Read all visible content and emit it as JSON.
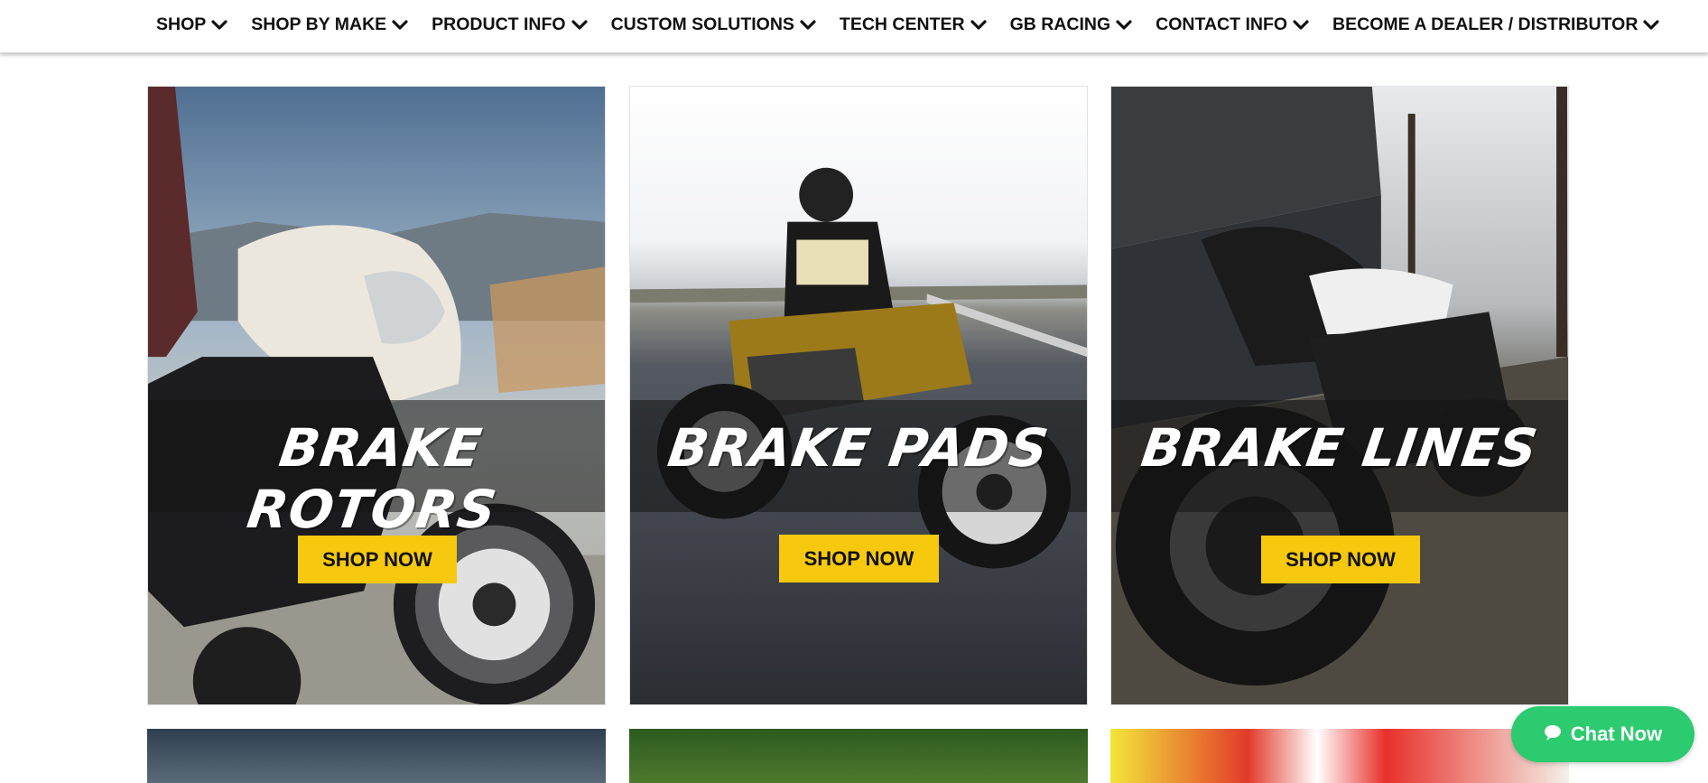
{
  "nav": {
    "items": [
      {
        "label": "SHOP"
      },
      {
        "label": "SHOP BY MAKE"
      },
      {
        "label": "PRODUCT INFO"
      },
      {
        "label": "CUSTOM SOLUTIONS"
      },
      {
        "label": "TECH CENTER"
      },
      {
        "label": "GB RACING"
      },
      {
        "label": "CONTACT INFO"
      },
      {
        "label": "BECOME A DEALER / DISTRIBUTOR"
      }
    ],
    "chevron_icon": "chevron-down-icon"
  },
  "cards": [
    {
      "title": "BRAKE ROTORS",
      "button": "SHOP NOW"
    },
    {
      "title": "BRAKE PADS",
      "button": "SHOP NOW"
    },
    {
      "title": "BRAKE LINES",
      "button": "SHOP NOW"
    }
  ],
  "chat": {
    "label": "Chat Now",
    "icon": "chat-bubble-icon"
  },
  "colors": {
    "accent_yellow": "#f6c90e",
    "chat_green": "#2ccb6f",
    "nav_text": "#111111"
  }
}
